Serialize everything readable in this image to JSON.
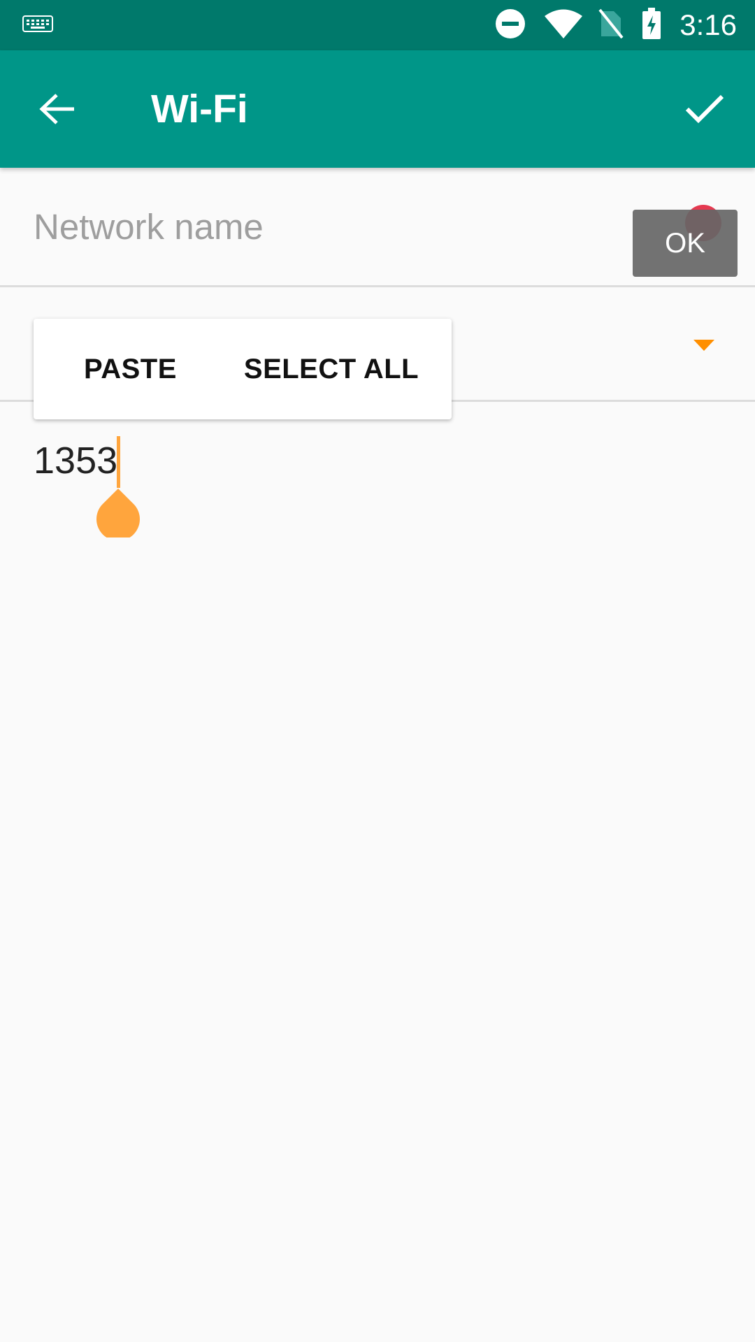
{
  "status_bar": {
    "time": "3:16",
    "icons": [
      "keyboard-icon",
      "do-not-disturb-icon",
      "wifi-icon",
      "no-sim-icon",
      "battery-charging-icon"
    ]
  },
  "toolbar": {
    "title": "Wi-Fi",
    "back_icon": "arrow-back-icon",
    "confirm_icon": "check-icon"
  },
  "network_field": {
    "placeholder": "Network name",
    "value": ""
  },
  "tooltip": {
    "label": "OK"
  },
  "security_dropdown": {
    "icon": "dropdown-arrow-icon"
  },
  "text_selection_menu": {
    "paste_label": "PASTE",
    "select_all_label": "SELECT ALL"
  },
  "password_field": {
    "value": "1353"
  },
  "colors": {
    "status_bar": "#00796b",
    "toolbar": "#009688",
    "accent": "#ff8f00",
    "cursor": "#ffa53d",
    "error": "#e53950"
  }
}
